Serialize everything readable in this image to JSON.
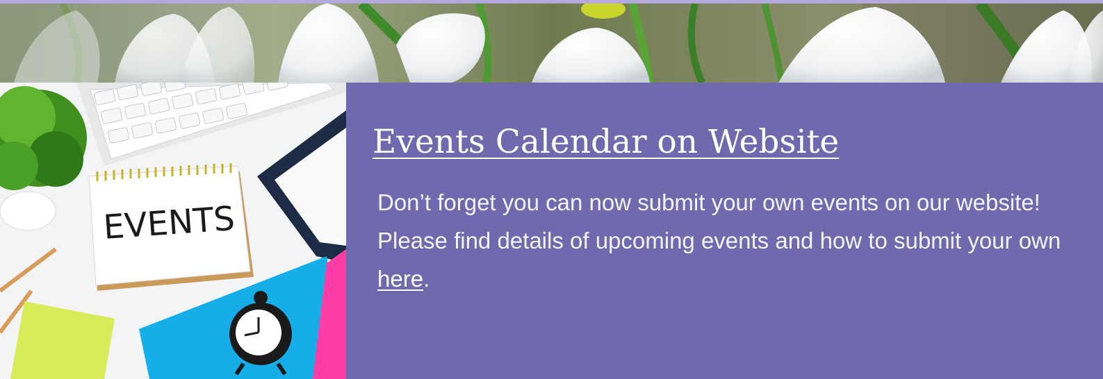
{
  "colors": {
    "accent_strip": "#b4a9dc",
    "panel_background": "#6f6aad",
    "panel_text": "#ffffff"
  },
  "banner": {
    "image": "snowdrop-flowers-photo"
  },
  "photo": {
    "image": "events-desk-photo",
    "notepad_text": "EVENTS"
  },
  "content": {
    "heading": "Events Calendar on Website",
    "body_before_link": "Don’t forget you can now submit your own events on our website! Please find details of upcoming events and how to submit your own ",
    "link_text": "here",
    "body_after_link": "."
  }
}
